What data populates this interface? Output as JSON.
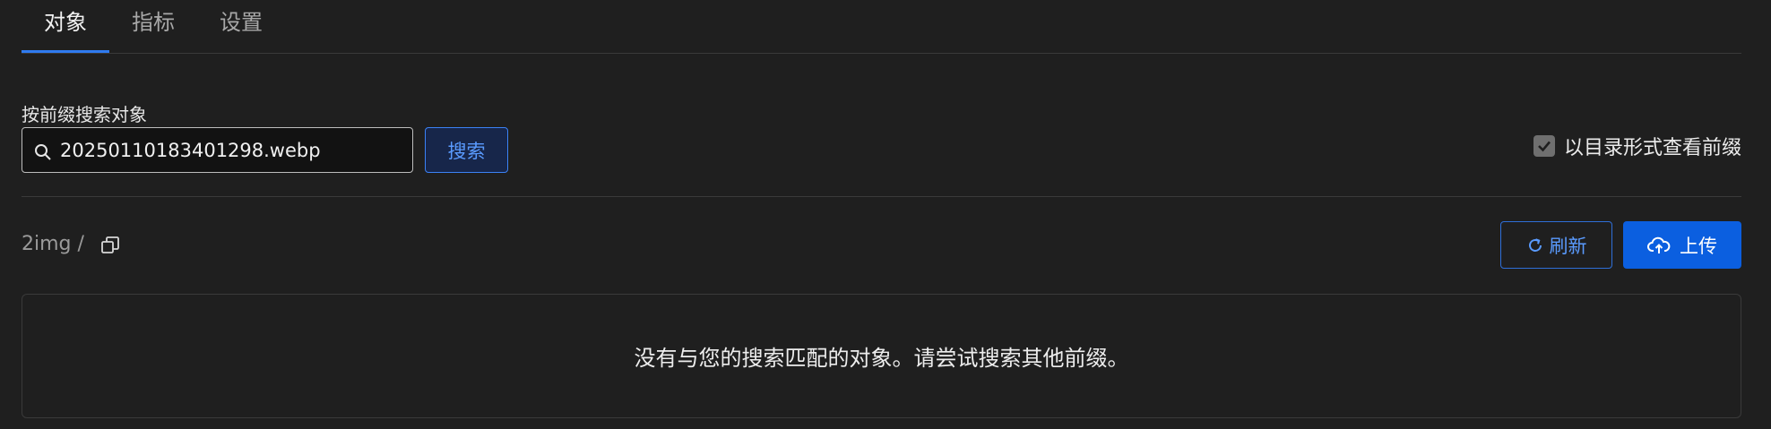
{
  "tabs": [
    {
      "label": "对象",
      "active": true
    },
    {
      "label": "指标",
      "active": false
    },
    {
      "label": "设置",
      "active": false
    }
  ],
  "search": {
    "label": "按前缀搜索对象",
    "value": "20250110183401298.webp",
    "button_label": "搜索",
    "icon": "search-icon"
  },
  "directory_view": {
    "label": "以目录形式查看前缀",
    "checked": true
  },
  "path": {
    "text": "2img /"
  },
  "actions": {
    "refresh_label": "刷新",
    "upload_label": "上传"
  },
  "results": {
    "empty_message": "没有与您的搜索匹配的对象。请尝试搜索其他前缀。"
  },
  "colors": {
    "background": "#1f1f1f",
    "accent": "#2f7bf0",
    "primary_button": "#0b5fe0"
  }
}
